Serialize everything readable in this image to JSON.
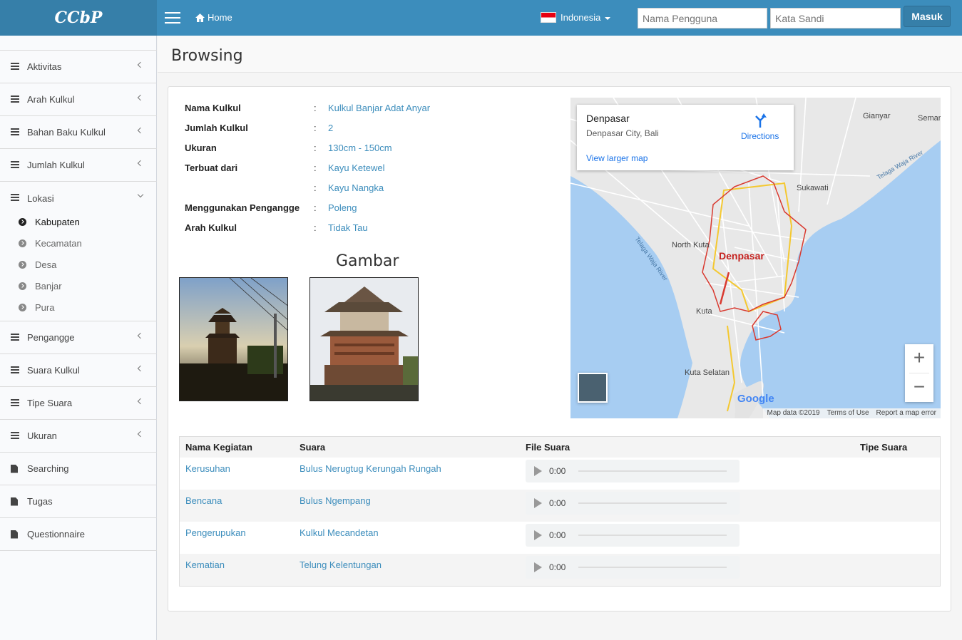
{
  "header": {
    "logo": "CCbP",
    "home": "Home",
    "language": "Indonesia",
    "username_placeholder": "Nama Pengguna",
    "password_placeholder": "Kata Sandi",
    "login": "Masuk"
  },
  "sidebar": {
    "items_top": [
      "Aktivitas",
      "Arah Kulkul",
      "Bahan Baku Kulkul",
      "Jumlah Kulkul"
    ],
    "lokasi": "Lokasi",
    "lokasi_sub": [
      "Kabupaten",
      "Kecamatan",
      "Desa",
      "Banjar",
      "Pura"
    ],
    "items_bottom": [
      "Pengangge",
      "Suara Kulkul",
      "Tipe Suara",
      "Ukuran"
    ],
    "docs": [
      "Searching",
      "Tugas",
      "Questionnaire"
    ]
  },
  "page": {
    "title": "Browsing"
  },
  "info": [
    {
      "k": "Nama Kulkul",
      "v": "Kulkul Banjar Adat Anyar"
    },
    {
      "k": "Jumlah Kulkul",
      "v": "2"
    },
    {
      "k": "Ukuran",
      "v": "130cm - 150cm"
    },
    {
      "k": "Terbuat dari",
      "v": "Kayu Ketewel"
    },
    {
      "k": "",
      "v": "Kayu Nangka"
    },
    {
      "k": "Menggunakan Pengangge",
      "v": "Poleng"
    },
    {
      "k": "Arah Kulkul",
      "v": "Tidak Tau"
    }
  ],
  "info_sep": ":",
  "gambar_title": "Gambar",
  "map": {
    "place": "Denpasar",
    "sub": "Denpasar City, Bali",
    "directions": "Directions",
    "larger": "View larger map",
    "label_city": "Denpasar",
    "labels": [
      "Gianyar",
      "Semar",
      "Sukawati",
      "North Kuta",
      "Kuta",
      "Kuta Selatan",
      "Telaga Waja River",
      "Telaga Waja River"
    ],
    "google": "Google",
    "footer": [
      "Map data ©2019",
      "Terms of Use",
      "Report a map error"
    ],
    "zoom_in": "+",
    "zoom_out": "−"
  },
  "table": {
    "headers": [
      "Nama Kegiatan",
      "Suara",
      "File Suara",
      "Tipe Suara"
    ],
    "rows": [
      {
        "kegiatan": "Kerusuhan",
        "suara": "Bulus Nerugtug Kerungah Rungah",
        "time": "0:00"
      },
      {
        "kegiatan": "Bencana",
        "suara": "Bulus Ngempang",
        "time": "0:00"
      },
      {
        "kegiatan": "Pengerupukan",
        "suara": "Kulkul Mecandetan",
        "time": "0:00"
      },
      {
        "kegiatan": "Kematian",
        "suara": "Telung Kelentungan",
        "time": "0:00"
      }
    ]
  },
  "colors": {
    "primary": "#3c8dbc",
    "header_dark": "#367fa9",
    "water": "#a7cdf2",
    "land": "#e8e8e8",
    "boundary": "#d93a30"
  }
}
